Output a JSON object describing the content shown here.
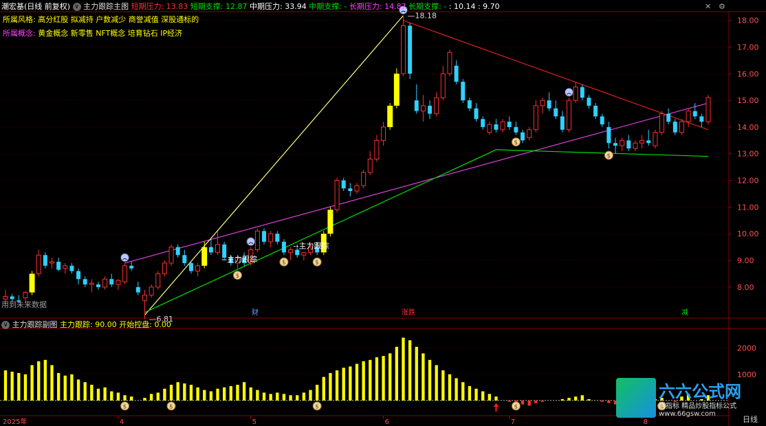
{
  "header": {
    "stock": "潮宏基(日线 前复权)",
    "indicator_name": "主力跟踪主图",
    "items": [
      {
        "label": "短期压力:",
        "value": "13.83",
        "color": "#ff3030"
      },
      {
        "label": "短期支撑:",
        "value": "12.87",
        "color": "#00e000"
      },
      {
        "label": "中期压力:",
        "value": "33.94",
        "color": "#ffffff"
      },
      {
        "label": "中期支撑:",
        "value": "-",
        "color": "#00e000"
      },
      {
        "label": "长期压力:",
        "value": "14.87",
        "color": "#ff40ff"
      },
      {
        "label": "长期支撑:",
        "value": "-",
        "color": "#00e000"
      },
      {
        "label": ":",
        "value": "10.14",
        "color": "#ffffff"
      },
      {
        "label": ":",
        "value": "9.70",
        "color": "#ffffff"
      }
    ]
  },
  "style_row": {
    "label": "所属风格:",
    "text": "高分红股 拟减持 户数减少 商誉减值 深股通标的"
  },
  "concept_row": {
    "label": "所属概念:",
    "text": "黄金概念 新零售 NFT概念 培育钻石 IP经济"
  },
  "future_note": "用到未来数据",
  "main_annotations": {
    "high_label": "18.18",
    "low_label": "6.81",
    "track1": "--主力跟踪",
    "track2": "--主力跟踪"
  },
  "event_tags": [
    {
      "text": "财",
      "color": "#5aa0ff"
    },
    {
      "text": "涨跌",
      "color": "#ff3030"
    },
    {
      "text": "减",
      "color": "#00e000"
    }
  ],
  "sub_header": {
    "name": "主力跟踪副图",
    "items": [
      {
        "label": "主力跟踪:",
        "value": "90.00"
      },
      {
        "label": "开始控盘:",
        "value": "0.00"
      }
    ]
  },
  "sub_axis": [
    "2000",
    "1000"
  ],
  "xaxis_labels": [
    "2025年",
    "4",
    "5",
    "6",
    "7",
    "8"
  ],
  "bottom_right": "日线",
  "watermark": {
    "brand": "六六公式网",
    "sub": "票指标 精品炒股指标公式",
    "url": "www.66gsw.com"
  },
  "colors": {
    "up": "#ff3030",
    "down": "#30d0ff",
    "yellow": "#ffff00",
    "support": "#00e000",
    "long": "#e040e0",
    "thin": "#ffff80"
  },
  "chart_data": {
    "type": "candlestick",
    "ylim": [
      7.3,
      18.3
    ],
    "yticks": [
      8,
      9,
      10,
      11,
      12,
      13,
      14,
      15,
      16,
      17,
      18
    ],
    "candles": [
      [
        7.55,
        7.9,
        7.35,
        7.65
      ],
      [
        7.65,
        7.75,
        7.45,
        7.55
      ],
      [
        7.5,
        7.7,
        7.4,
        7.45
      ],
      [
        7.6,
        7.85,
        7.4,
        7.8
      ],
      [
        7.8,
        8.6,
        7.7,
        8.5
      ],
      [
        8.5,
        9.4,
        8.4,
        9.2
      ],
      [
        9.2,
        9.3,
        8.7,
        8.8
      ],
      [
        8.9,
        9.1,
        8.7,
        8.95
      ],
      [
        8.95,
        9.1,
        8.6,
        8.65
      ],
      [
        8.7,
        8.9,
        8.5,
        8.8
      ],
      [
        8.8,
        8.9,
        8.5,
        8.6
      ],
      [
        8.6,
        8.7,
        8.1,
        8.3
      ],
      [
        8.3,
        8.4,
        8.0,
        8.1
      ],
      [
        8.1,
        8.3,
        7.8,
        8.15
      ],
      [
        8.1,
        8.2,
        7.9,
        8.0
      ],
      [
        8.0,
        8.4,
        7.9,
        8.3
      ],
      [
        8.3,
        8.5,
        8.0,
        8.1
      ],
      [
        8.1,
        8.3,
        7.9,
        8.25
      ],
      [
        8.2,
        8.9,
        8.1,
        8.8
      ],
      [
        8.8,
        8.95,
        8.6,
        8.7
      ],
      [
        8.0,
        8.2,
        7.7,
        7.8
      ],
      [
        7.5,
        7.9,
        6.81,
        7.7
      ],
      [
        7.7,
        8.1,
        7.6,
        8.0
      ],
      [
        8.0,
        8.6,
        7.9,
        8.5
      ],
      [
        8.5,
        9.0,
        8.4,
        8.9
      ],
      [
        8.9,
        9.6,
        8.8,
        9.5
      ],
      [
        9.5,
        9.6,
        9.1,
        9.2
      ],
      [
        9.2,
        9.4,
        8.8,
        8.9
      ],
      [
        8.9,
        9.0,
        8.5,
        8.6
      ],
      [
        8.6,
        8.9,
        8.4,
        8.8
      ],
      [
        8.8,
        9.7,
        8.7,
        9.5
      ],
      [
        9.5,
        9.8,
        9.2,
        9.3
      ],
      [
        9.3,
        10.1,
        9.2,
        9.6
      ],
      [
        9.6,
        9.7,
        9.0,
        9.1
      ],
      [
        9.1,
        9.2,
        8.8,
        8.9
      ],
      [
        8.9,
        9.2,
        8.7,
        9.1
      ],
      [
        9.1,
        9.3,
        8.8,
        8.9
      ],
      [
        8.9,
        9.5,
        8.8,
        9.4
      ],
      [
        9.4,
        10.2,
        9.3,
        10.1
      ],
      [
        10.1,
        10.2,
        9.6,
        9.7
      ],
      [
        9.7,
        10.1,
        9.5,
        10.0
      ],
      [
        10.0,
        10.1,
        9.6,
        9.7
      ],
      [
        9.7,
        9.8,
        9.2,
        9.3
      ],
      [
        9.3,
        9.5,
        9.0,
        9.4
      ],
      [
        9.4,
        9.6,
        9.1,
        9.2
      ],
      [
        9.2,
        9.3,
        9.0,
        9.3
      ],
      [
        9.3,
        9.6,
        9.2,
        9.5
      ],
      [
        9.5,
        9.7,
        9.2,
        9.3
      ],
      [
        9.3,
        10.1,
        9.2,
        10.0
      ],
      [
        10.0,
        11.0,
        9.9,
        10.9
      ],
      [
        10.9,
        12.1,
        10.8,
        12.0
      ],
      [
        12.0,
        12.1,
        11.6,
        11.7
      ],
      [
        11.7,
        11.9,
        11.4,
        11.6
      ],
      [
        11.6,
        11.9,
        11.5,
        11.8
      ],
      [
        11.8,
        12.4,
        11.7,
        12.3
      ],
      [
        12.3,
        13.1,
        12.2,
        12.8
      ],
      [
        12.8,
        13.7,
        12.7,
        13.5
      ],
      [
        13.5,
        14.2,
        13.3,
        14.0
      ],
      [
        14.0,
        14.9,
        13.9,
        14.8
      ],
      [
        14.8,
        16.2,
        14.7,
        16.0
      ],
      [
        16.0,
        18.18,
        15.9,
        17.8
      ],
      [
        17.8,
        17.9,
        15.8,
        16.0
      ],
      [
        15.0,
        15.6,
        14.5,
        14.6
      ],
      [
        14.6,
        15.2,
        14.2,
        14.8
      ],
      [
        14.8,
        15.0,
        14.3,
        14.5
      ],
      [
        14.5,
        15.3,
        14.4,
        15.1
      ],
      [
        15.1,
        16.3,
        15.0,
        16.0
      ],
      [
        16.0,
        16.9,
        15.9,
        16.8
      ],
      [
        16.3,
        16.5,
        15.6,
        15.7
      ],
      [
        15.7,
        15.8,
        14.9,
        15.0
      ],
      [
        15.0,
        15.1,
        14.6,
        14.7
      ],
      [
        14.7,
        14.9,
        14.2,
        14.3
      ],
      [
        14.3,
        14.4,
        13.9,
        14.0
      ],
      [
        13.8,
        14.2,
        13.7,
        14.1
      ],
      [
        14.1,
        14.3,
        13.8,
        13.9
      ],
      [
        13.9,
        14.3,
        13.8,
        14.2
      ],
      [
        14.2,
        14.4,
        13.9,
        14.0
      ],
      [
        14.0,
        14.2,
        13.7,
        13.8
      ],
      [
        13.8,
        13.9,
        13.4,
        13.5
      ],
      [
        13.6,
        14.0,
        13.5,
        13.9
      ],
      [
        13.9,
        15.0,
        13.8,
        14.8
      ],
      [
        14.8,
        15.1,
        14.5,
        15.0
      ],
      [
        15.0,
        15.3,
        14.6,
        14.7
      ],
      [
        14.7,
        15.0,
        14.3,
        14.4
      ],
      [
        14.4,
        14.6,
        13.8,
        13.9
      ],
      [
        13.9,
        15.1,
        13.8,
        15.0
      ],
      [
        15.0,
        15.7,
        14.9,
        15.5
      ],
      [
        15.5,
        15.6,
        15.0,
        15.1
      ],
      [
        15.1,
        15.2,
        14.7,
        14.8
      ],
      [
        14.8,
        14.9,
        14.3,
        14.4
      ],
      [
        14.4,
        14.5,
        14.0,
        14.1
      ],
      [
        14.0,
        14.2,
        13.2,
        13.4
      ],
      [
        13.4,
        13.6,
        13.0,
        13.3
      ],
      [
        13.3,
        13.6,
        13.1,
        13.5
      ],
      [
        13.5,
        13.7,
        13.1,
        13.2
      ],
      [
        13.2,
        13.5,
        13.1,
        13.4
      ],
      [
        13.4,
        13.7,
        13.2,
        13.5
      ],
      [
        13.5,
        13.9,
        13.3,
        13.4
      ],
      [
        13.3,
        13.9,
        13.2,
        13.8
      ],
      [
        13.8,
        14.6,
        13.7,
        14.5
      ],
      [
        14.5,
        14.7,
        14.1,
        14.2
      ],
      [
        14.2,
        14.3,
        13.7,
        13.8
      ],
      [
        13.8,
        14.3,
        13.7,
        14.2
      ],
      [
        14.2,
        14.7,
        14.0,
        14.6
      ],
      [
        14.6,
        14.9,
        14.3,
        14.4
      ],
      [
        14.4,
        14.5,
        14.0,
        14.2
      ],
      [
        14.2,
        15.2,
        14.1,
        15.1
      ]
    ],
    "yellow_bars": [
      4,
      30,
      48,
      49,
      58,
      59
    ],
    "markers": {
      "sad_faces": [
        18,
        37,
        60,
        85
      ],
      "money_bags": [
        35,
        42,
        47,
        77,
        91
      ]
    },
    "lines": {
      "long_pressure": [
        [
          18,
          8.9
        ],
        [
          106,
          14.9
        ]
      ],
      "short_pressure": [
        [
          60,
          18.0
        ],
        [
          106,
          13.9
        ]
      ],
      "thin_up": [
        [
          21,
          6.95
        ],
        [
          60,
          18.18
        ]
      ],
      "support": [
        [
          21,
          7.05
        ],
        [
          74,
          13.15
        ],
        [
          106,
          12.9
        ]
      ]
    },
    "sub_volume_bars": [
      1150,
      1100,
      1050,
      1000,
      1350,
      1500,
      1550,
      1350,
      1050,
      950,
      1000,
      800,
      700,
      600,
      450,
      500,
      350,
      300,
      200,
      150,
      0,
      100,
      250,
      300,
      450,
      600,
      700,
      650,
      600,
      500,
      400,
      350,
      450,
      500,
      550,
      600,
      700,
      500,
      400,
      300,
      250,
      300,
      250,
      200,
      200,
      300,
      400,
      600,
      900,
      1050,
      1150,
      1250,
      1300,
      1400,
      1500,
      1550,
      1650,
      1700,
      1800,
      2050,
      2400,
      2300,
      2050,
      1800,
      1550,
      1350,
      1150,
      1000,
      850,
      700,
      550,
      450,
      350,
      250,
      150,
      0,
      -50,
      -100,
      -150,
      -200,
      -100,
      -50,
      0,
      0,
      50,
      100,
      150,
      200,
      50,
      0,
      -50,
      -100,
      -150,
      -50,
      50,
      150,
      -100,
      -50,
      50,
      100,
      0,
      -50,
      150,
      250,
      0,
      50,
      200
    ],
    "sub_ylim": [
      -450,
      2700
    ]
  }
}
